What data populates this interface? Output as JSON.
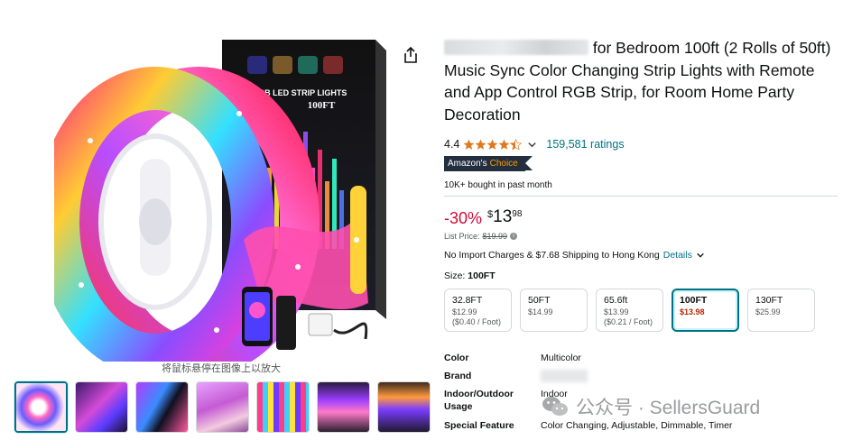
{
  "gallery": {
    "hover_hint": "将鼠标悬停在图像上以放大",
    "box_text": "RGB LED STRIP LIGHTS",
    "box_length": "100FT",
    "thumbnails": [
      {
        "name": "thumb-1",
        "selected": true
      },
      {
        "name": "thumb-2",
        "selected": false
      },
      {
        "name": "thumb-3",
        "selected": false
      },
      {
        "name": "thumb-4",
        "selected": false
      },
      {
        "name": "thumb-5",
        "selected": false
      },
      {
        "name": "thumb-6",
        "selected": false
      },
      {
        "name": "thumb-7",
        "selected": false
      }
    ]
  },
  "product": {
    "title_rest": "for Bedroom 100ft (2 Rolls of 50ft) Music Sync Color Changing Strip Lights with Remote and App Control RGB Strip, for Room Home Party Decoration",
    "rating": "4.4",
    "rating_stars": 4.4,
    "ratings_count": "159,581 ratings",
    "badge_prefix": "Amazon's",
    "badge_accent": "Choice",
    "bought": "10K+ bought in past month",
    "discount": "-30%",
    "currency": "$",
    "price_whole": "13",
    "price_fraction": "98",
    "list_price_label": "List Price:",
    "list_price": "$19.99",
    "shipping_text": "No Import Charges & $7.68 Shipping to Hong Kong",
    "details_link": "Details",
    "size_label": "Size:",
    "size_selected": "100FT"
  },
  "size_options": [
    {
      "name": "32.8FT",
      "price": "$12.99",
      "unit": "($0.40 / Foot)"
    },
    {
      "name": "50FT",
      "price": "$14.99",
      "unit": ""
    },
    {
      "name": "65.6ft",
      "price": "$13.99",
      "unit": "($0.21 / Foot)"
    },
    {
      "name": "100FT",
      "price": "$13.98",
      "unit": ""
    },
    {
      "name": "130FT",
      "price": "$25.99",
      "unit": ""
    }
  ],
  "specs": [
    {
      "key": "Color",
      "value": "Multicolor"
    },
    {
      "key": "Brand",
      "value": ""
    },
    {
      "key": "Indoor/Outdoor Usage",
      "value": "Indoor"
    },
    {
      "key": "Special Feature",
      "value": "Color Changing, Adjustable, Dimmable, Timer"
    }
  ],
  "watermark": {
    "text": "公众号 · SellersGuard"
  },
  "colors": {
    "link": "#007185",
    "deal_red": "#cc0c39",
    "star": "#de7921",
    "badge_bg": "#232f3e",
    "badge_accent": "#ff9900"
  },
  "icons": [
    "share-icon",
    "star-icon",
    "chevron-down-icon",
    "info-icon",
    "wechat-icon"
  ]
}
